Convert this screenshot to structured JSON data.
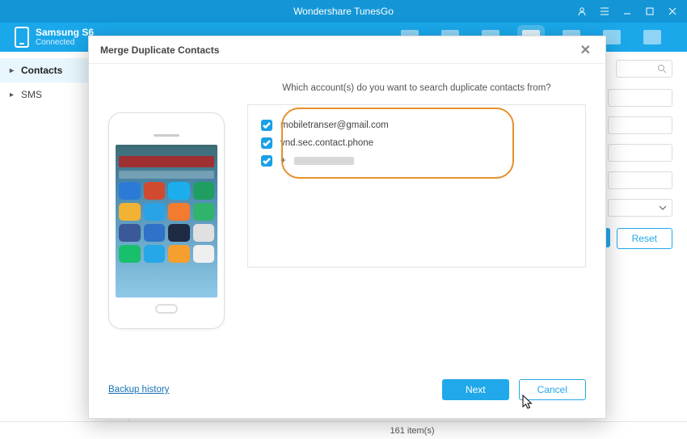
{
  "titlebar": {
    "title": "Wondershare TunesGo"
  },
  "device": {
    "name": "Samsung S6",
    "status": "Connected"
  },
  "sidebar": {
    "items": [
      {
        "label": "Contacts",
        "active": true
      },
      {
        "label": "SMS",
        "active": false
      }
    ]
  },
  "main": {
    "reset_label": "Reset"
  },
  "modal": {
    "title": "Merge Duplicate Contacts",
    "question": "Which account(s) do you want to search duplicate contacts from?",
    "accounts": [
      {
        "label": "mobiletranser@gmail.com",
        "checked": true
      },
      {
        "label": "vnd.sec.contact.phone",
        "checked": true
      },
      {
        "label": "+",
        "checked": true,
        "redacted": true
      }
    ],
    "backup_link": "Backup history",
    "next_label": "Next",
    "cancel_label": "Cancel"
  },
  "statusbar": {
    "count_text": "161 item(s)"
  },
  "app_colors": [
    "#2b7bd6",
    "#d04a2f",
    "#1caeec",
    "#209e62",
    "#f2b233",
    "#2aa2e6",
    "#f27b2f",
    "#32b36c",
    "#3b5998",
    "#3071c9",
    "#1f2a44",
    "#e0e0e0",
    "#19c06c",
    "#25a7e8",
    "#f59f2f",
    "#efefef"
  ]
}
